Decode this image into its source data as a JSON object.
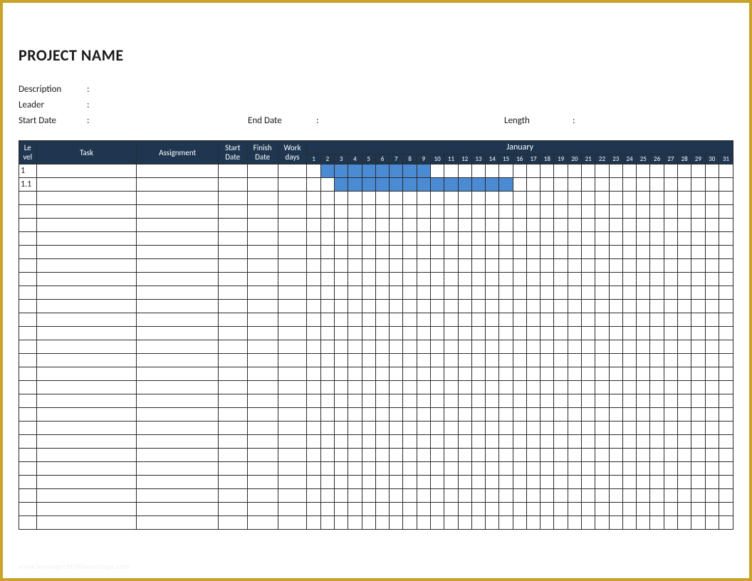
{
  "title": "PROJECT NAME",
  "meta": {
    "description_label": "Description",
    "leader_label": "Leader",
    "startdate_label": "Start Date",
    "enddate_label": "End Date",
    "length_label": "Length",
    "colon": ":"
  },
  "headers": {
    "level": "Le vel",
    "task": "Task",
    "assignment": "Assignment",
    "start_date": "Start Date",
    "finish_date": "Finish Date",
    "work_days": "Work days",
    "month": "January"
  },
  "days": [
    "1",
    "2",
    "3",
    "4",
    "5",
    "6",
    "7",
    "8",
    "9",
    "10",
    "11",
    "12",
    "13",
    "14",
    "15",
    "16",
    "17",
    "18",
    "19",
    "20",
    "21",
    "22",
    "23",
    "24",
    "25",
    "26",
    "27",
    "28",
    "29",
    "30",
    "31"
  ],
  "rows": [
    {
      "level": "1",
      "bar_start": 2,
      "bar_end": 9
    },
    {
      "level": "1.1",
      "bar_start": 3,
      "bar_end": 15
    },
    {
      "level": ""
    },
    {
      "level": ""
    },
    {
      "level": ""
    },
    {
      "level": ""
    },
    {
      "level": ""
    },
    {
      "level": ""
    },
    {
      "level": ""
    },
    {
      "level": ""
    },
    {
      "level": ""
    },
    {
      "level": ""
    },
    {
      "level": ""
    },
    {
      "level": ""
    },
    {
      "level": ""
    },
    {
      "level": ""
    },
    {
      "level": ""
    },
    {
      "level": ""
    },
    {
      "level": ""
    },
    {
      "level": ""
    },
    {
      "level": ""
    },
    {
      "level": ""
    },
    {
      "level": ""
    },
    {
      "level": ""
    },
    {
      "level": ""
    },
    {
      "level": ""
    },
    {
      "level": ""
    }
  ],
  "chart_data": {
    "type": "gantt",
    "month": "January",
    "days_range": [
      1,
      31
    ],
    "tasks": [
      {
        "level": "1",
        "task": "",
        "assignment": "",
        "start_date": "",
        "finish_date": "",
        "work_days": "",
        "bar_start_day": 2,
        "bar_end_day": 9
      },
      {
        "level": "1.1",
        "task": "",
        "assignment": "",
        "start_date": "",
        "finish_date": "",
        "work_days": "",
        "bar_start_day": 3,
        "bar_end_day": 15
      }
    ],
    "empty_rows": 25
  },
  "watermark": "www.heritagechristiancollege.com"
}
